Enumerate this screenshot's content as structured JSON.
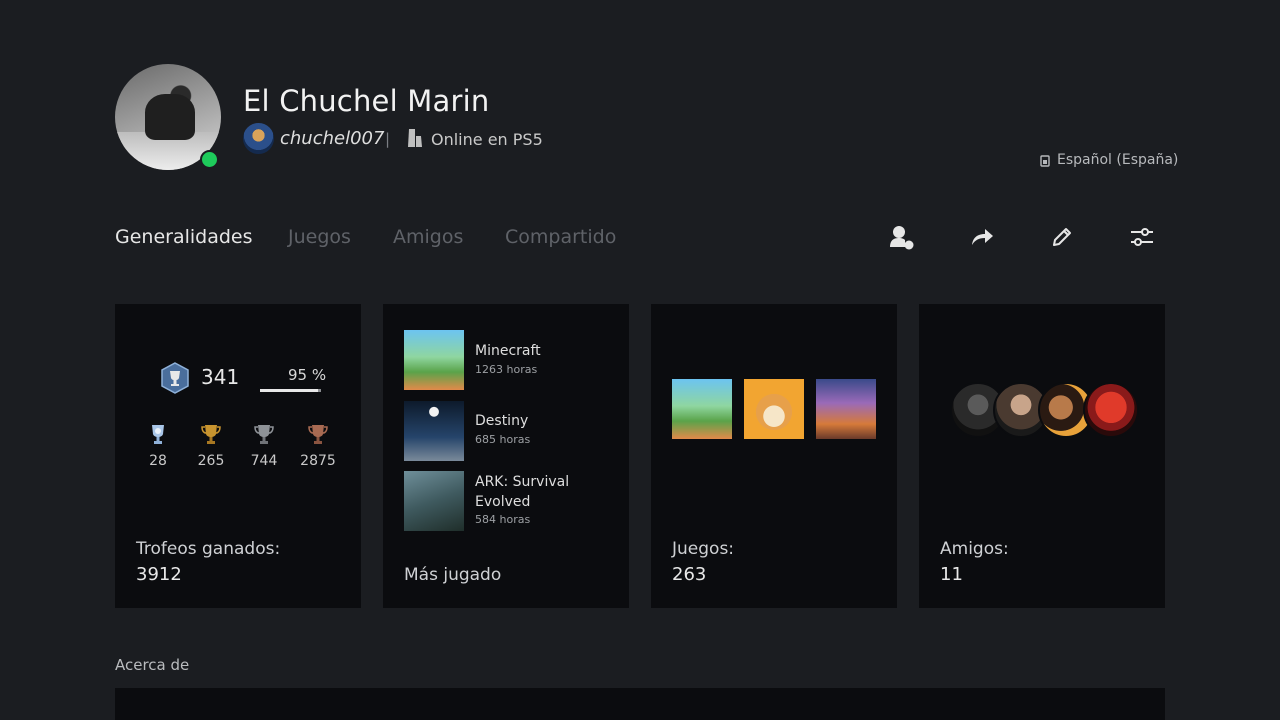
{
  "profile": {
    "display_name": "El Chuchel Marin",
    "online_id": "chuchel007",
    "separator": "|",
    "status": "Online en PS5",
    "language": "Español (España)"
  },
  "tabs": [
    {
      "label": "Generalidades",
      "active": true
    },
    {
      "label": "Juegos",
      "active": false
    },
    {
      "label": "Amigos",
      "active": false
    },
    {
      "label": "Compartido",
      "active": false
    }
  ],
  "actions": [
    {
      "icon": "add-friend-icon"
    },
    {
      "icon": "share-icon"
    },
    {
      "icon": "edit-icon"
    },
    {
      "icon": "settings-sliders-icon"
    }
  ],
  "trophies": {
    "level": "341",
    "progress_text": "95 %",
    "progress": 0.95,
    "platinum": "28",
    "gold": "265",
    "silver": "744",
    "bronze": "2875",
    "label": "Trofeos ganados:",
    "total": "3912"
  },
  "most_played": {
    "label": "Más jugado",
    "games": [
      {
        "title": "Minecraft",
        "hours": "1263 horas"
      },
      {
        "title": "Destiny",
        "hours": "685 horas"
      },
      {
        "title_line1": "ARK: Survival",
        "title_line2": "Evolved",
        "hours": "584 horas"
      }
    ]
  },
  "games": {
    "label": "Juegos:",
    "count": "263"
  },
  "friends": {
    "label": "Amigos:",
    "count": "11"
  },
  "about": {
    "label": "Acerca de"
  },
  "colors": {
    "background": "#1b1d21",
    "card": "#0b0c0f",
    "online": "#1ecb5b"
  }
}
